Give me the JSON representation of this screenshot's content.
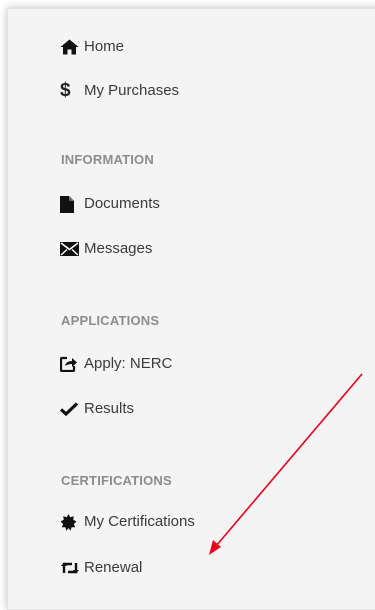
{
  "nav": {
    "home_label": "Home",
    "purchases_label": "My Purchases",
    "purchases_symbol": "$"
  },
  "sections": {
    "information": {
      "header": "INFORMATION",
      "documents_label": "Documents",
      "messages_label": "Messages"
    },
    "applications": {
      "header": "APPLICATIONS",
      "apply_label": "Apply: NERC",
      "results_label": "Results"
    },
    "certifications": {
      "header": "CERTIFICATIONS",
      "my_certifications_label": "My Certifications",
      "renewal_label": "Renewal"
    }
  },
  "icons": {
    "home": "home-icon",
    "purchases": "dollar-icon",
    "documents": "document-icon",
    "messages": "envelope-icon",
    "apply": "share-icon",
    "results": "check-icon",
    "certifications": "certificate-icon",
    "renewal": "retweet-icon"
  },
  "colors": {
    "text": "#3b3b3b",
    "section_header": "#8c8c8c",
    "annotation_arrow": "#e8001c",
    "panel_background": "#f4f4f4"
  }
}
